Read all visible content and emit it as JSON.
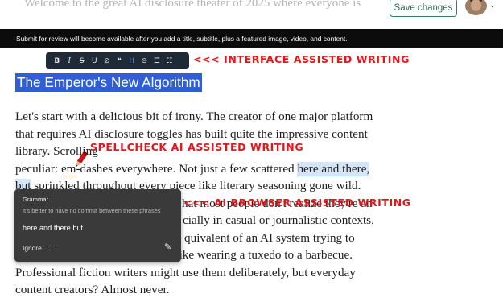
{
  "top": {
    "ghost_text": "Welcome to the great AI disclosure theater of 2025 where everyone is",
    "save_label": "Save changes",
    "avatar_icon": "user-avatar",
    "chevron_icon": "chevron-down-icon"
  },
  "notice": {
    "text": "Submit for review will become available after you add a title, subtitle, plus a featured image, video, and content."
  },
  "toolbar": {
    "buttons": [
      {
        "label": "B",
        "icon": "bold-icon"
      },
      {
        "label": "I",
        "icon": "italic-icon"
      },
      {
        "label": "S",
        "icon": "strikethrough-icon"
      },
      {
        "label": "U",
        "icon": "underline-icon"
      },
      {
        "label": "⊘",
        "icon": "clear-format-icon"
      },
      {
        "label": "❝",
        "icon": "quote-icon"
      },
      {
        "label": "H",
        "icon": "heading-icon"
      },
      {
        "label": "⊝",
        "icon": "link-icon"
      },
      {
        "label": "☰",
        "icon": "ordered-list-icon"
      },
      {
        "label": "☷",
        "icon": "bullet-list-icon"
      }
    ]
  },
  "annotations": {
    "interface": "<<< INTERFACE ASSISTED WRITING",
    "spellcheck": "SPELLCHECK AI ASSISTED WRITING",
    "browser": "<<< AI BROWSER ASSISTED WRITING"
  },
  "article": {
    "title": "The Emperor's New Algorithm",
    "lines": {
      "l1": "Let's start with a delicious bit of irony. The creator of one major platform",
      "l2": "that requires AI disclosure toggles has built quite the impressive content",
      "l3": "library. Scrolling",
      "l4a": "peculiar: ",
      "l4b": "em",
      "l4c": "-dashes everywhere. Not just a few scattered ",
      "l4d": "here and there,",
      "l5a": "but",
      "l5b": " sprinkled throughout every piece like literary seasoning gone wild.",
      "l6": "hat most people don't realize they're an",
      "l7": "cially in casual or journalistic contexts,",
      "l8": "quivalent of an AI system trying to",
      "l9": "sound sophisticated and literary, like wearing a tuxedo to a barbecue.",
      "l10": "Professional fiction writers might use them deliberately, but everyday",
      "l11": "content creators? Almost never."
    }
  },
  "grammar_popup": {
    "header": "Grammar",
    "description": "It's better to have no comma between these phrases",
    "suggestion": "here and there but",
    "ignore_label": "Ignore",
    "more_label": "···",
    "pen_icon": "pen-icon"
  }
}
